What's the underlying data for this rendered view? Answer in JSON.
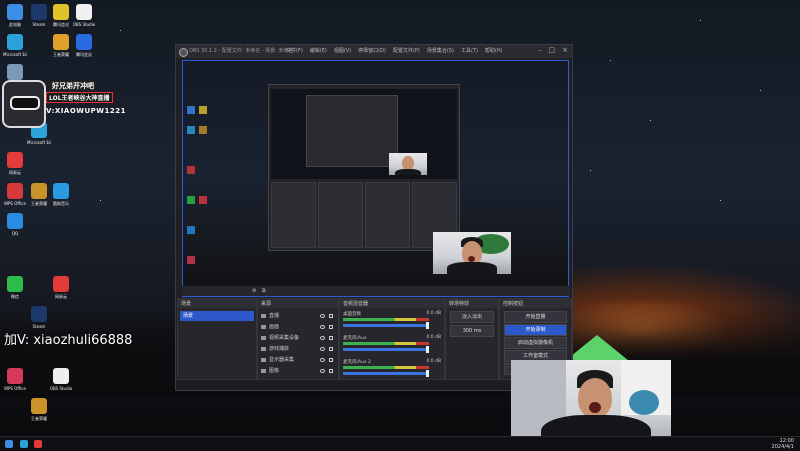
{
  "desktop_icons": [
    {
      "label": "此电脑",
      "color": "#3a8ee6",
      "icon": "computer-icon"
    },
    {
      "label": "Microsoft Edge",
      "color": "#2aa3d8",
      "icon": "edge-icon"
    },
    {
      "label": "回收站",
      "color": "#7a9ab8",
      "icon": "recycle-bin-icon"
    },
    {
      "label": "网易云",
      "color": "#e33a3a",
      "icon": "music-icon"
    },
    {
      "label": "WPS Office",
      "color": "#d63a3a",
      "icon": "wps-icon"
    },
    {
      "label": "QQ",
      "color": "#2a8ce0",
      "icon": "qq-icon"
    },
    {
      "label": "微信",
      "color": "#2ebd4a",
      "icon": "wechat-icon"
    },
    {
      "label": "Steam",
      "color": "#1b3a6b",
      "icon": "steam-icon"
    },
    {
      "label": "腾讯会议",
      "color": "#2a6ae0",
      "icon": "meeting-icon"
    },
    {
      "label": "王者荣耀",
      "color": "#c9932a",
      "icon": "game-icon"
    },
    {
      "label": "OBS Studio",
      "color": "#333333",
      "icon": "obs-icon"
    },
    {
      "label": "酷狗音乐",
      "color": "#2a9ae0",
      "icon": "kugou-icon"
    }
  ],
  "overlay": {
    "line1": "好兄弟开冲吧",
    "line2": "LOL王者峡谷大神直播",
    "line3": "V:XIAOWUPW1221"
  },
  "wechat_contact": "加V: xiaozhuli66888",
  "obs": {
    "title": "OBS 30.1.2 - 配置文件: 未命名 - 场景: 未命名",
    "menus": [
      "文件(F)",
      "编辑(E)",
      "视图(V)",
      "停靠窗口(D)",
      "配置文件(P)",
      "场景集合(S)",
      "工具(T)",
      "帮助(H)"
    ],
    "toolbar": [
      "⚙",
      "⧉"
    ],
    "scenes": {
      "header": "场景",
      "items": [
        "场景"
      ]
    },
    "sources": {
      "header": "来源",
      "items": [
        "直播",
        "画面",
        "视频采集设备",
        "游戏捕获",
        "显示器采集",
        "图像"
      ]
    },
    "mixer": {
      "header": "音频混音器",
      "channels": [
        {
          "name": "桌面音频",
          "db": "0.0 dB"
        },
        {
          "name": "麦克风/Aux",
          "db": "0.0 dB"
        },
        {
          "name": "麦克风/Aux 2",
          "db": "0.0 dB"
        }
      ]
    },
    "transitions": {
      "header": "转场特效",
      "type": "淡入淡出",
      "duration": "300 ms"
    },
    "controls": {
      "header": "控制按钮",
      "buttons": [
        "开始直播",
        "开始录制",
        "启动虚拟摄像机",
        "工作室模式",
        "设置",
        "退出"
      ]
    },
    "status": "LIVE: 00:00:00  REC: 00:00:00  CPU: 2.1%, 60.00 fps"
  },
  "taskbar": {
    "time": "12:00",
    "date": "2024/4/1"
  }
}
